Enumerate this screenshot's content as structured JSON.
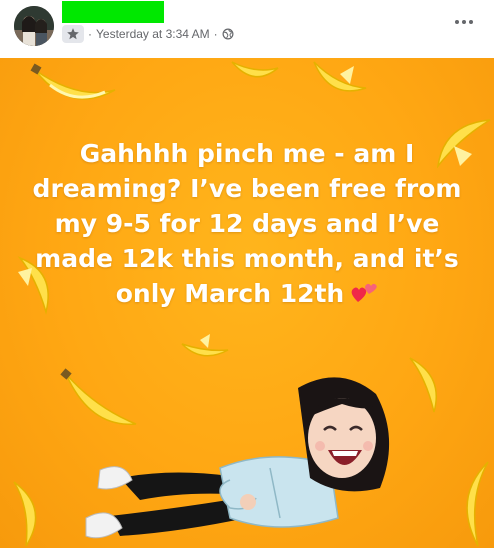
{
  "post": {
    "timestamp": "Yesterday at 3:34 AM",
    "separator": "·",
    "more_label": "•••",
    "message": "Gahhhh pinch me - am I dreaming? I’ve been free from my 9-5 for 12 days and I’ve made 12k this month, and it’s only March 12th"
  },
  "icons": {
    "badge": "star-badge-icon",
    "audience": "public-globe-icon",
    "more": "more-options-icon",
    "heart": "two-hearts-icon"
  },
  "colors": {
    "background": "#ffa713",
    "text": "#ffffff",
    "redaction": "#00e800",
    "meta_text": "#65676b"
  }
}
